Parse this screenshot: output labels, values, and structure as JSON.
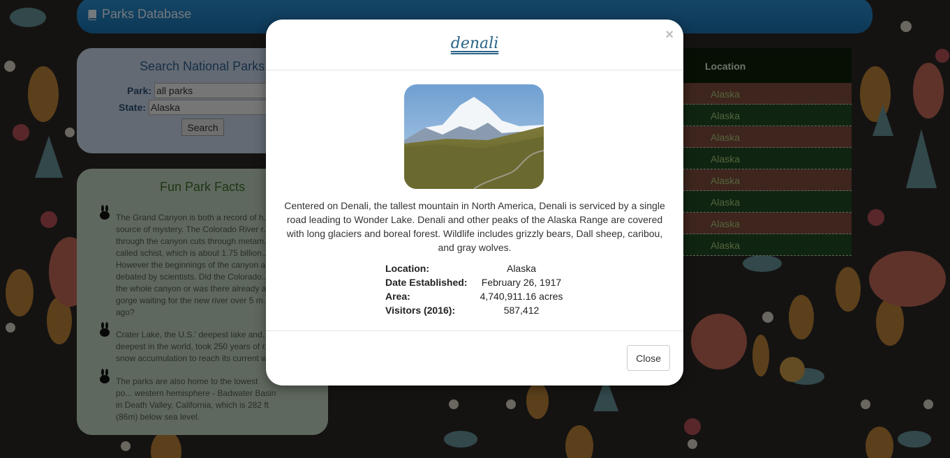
{
  "navbar": {
    "brand": "Parks Database",
    "icon": "book-icon"
  },
  "search": {
    "title": "Search National Parks",
    "park_label": "Park:",
    "park_value": "all parks",
    "state_label": "State:",
    "state_value": "Alaska",
    "button": "Search"
  },
  "facts": {
    "title": "Fun Park Facts",
    "items": [
      "The Grand Canyon is both a record of h... source of mystery. The Colorado River r... through the canyon cuts through metam... called schist, which is about 1.75 billion... However the beginnings of the canyon a... debated by scientists. Did the Colorado... the whole canyon or was there already a... gorge waiting for the new river over 5 m... ago?",
      "Crater Lake, the U.S.' deepest lake and... deepest in the world, took 250 years of r... snow accumulation to reach its current w...",
      "The parks are also home to the lowest po... western hemisphere - Badwater Basin in Death Valley, California, which is 282 ft (86m) below sea level."
    ]
  },
  "results": {
    "header": "Location",
    "rows": [
      "Alaska",
      "Alaska",
      "Alaska",
      "Alaska",
      "Alaska",
      "Alaska",
      "Alaska",
      "Alaska"
    ]
  },
  "modal": {
    "title": "denali",
    "close_symbol": "×",
    "description": "Centered on Denali, the tallest mountain in North America, Denali is serviced by a single road leading to Wonder Lake. Denali and other peaks of the Alaska Range are covered with long glaciers and boreal forest. Wildlife includes grizzly bears, Dall sheep, caribou, and gray wolves.",
    "details": [
      {
        "label": "Location:",
        "value": "Alaska"
      },
      {
        "label": "Date Established:",
        "value": "February 26, 1917"
      },
      {
        "label": "Area:",
        "value": "4,740,911.16 acres"
      },
      {
        "label": "Visitors (2016):",
        "value": "587,412"
      }
    ],
    "close_button": "Close"
  },
  "colors": {
    "navbar": "#1a6fae",
    "title_link": "#2a6486",
    "row_odd": "#7c4a3a",
    "row_even": "#1f4a23"
  }
}
